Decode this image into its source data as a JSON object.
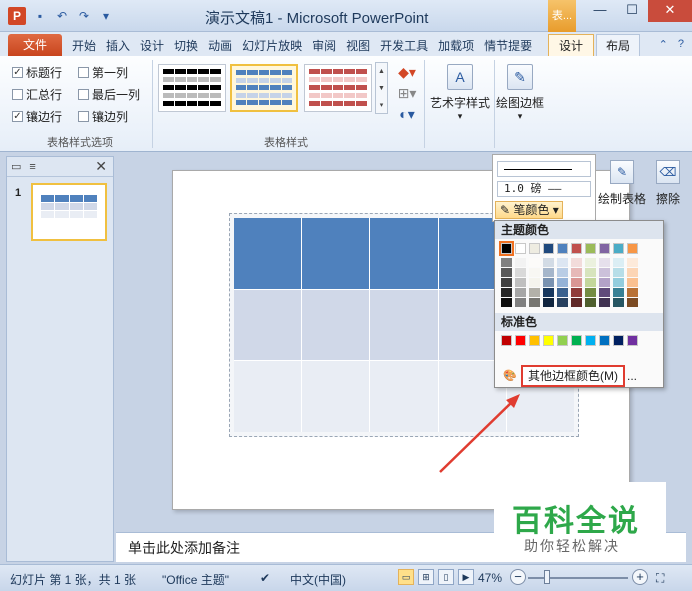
{
  "app": {
    "logo_letter": "P",
    "window_title": "演示文稿1 - Microsoft PowerPoint",
    "context_group": "表...",
    "window_buttons": {
      "minimize": "—",
      "restore": "☐",
      "close": "✕"
    }
  },
  "tabs": {
    "file": "文件",
    "items": [
      "开始",
      "插入",
      "设计",
      "切换",
      "动画",
      "幻灯片放映",
      "审阅",
      "视图",
      "开发工具",
      "加载项",
      "情节提要"
    ],
    "context_design": "设计",
    "context_layout": "布局"
  },
  "ribbon": {
    "options": {
      "header_row": {
        "label": "标题行",
        "checked": true
      },
      "first_column": {
        "label": "第一列",
        "checked": false
      },
      "total_row": {
        "label": "汇总行",
        "checked": false
      },
      "last_column": {
        "label": "最后一列",
        "checked": false
      },
      "banded_rows": {
        "label": "镶边行",
        "checked": true
      },
      "banded_columns": {
        "label": "镶边列",
        "checked": false
      },
      "group_label": "表格样式选项"
    },
    "styles_group_label": "表格样式",
    "wordart_label": "艺术字样式",
    "draw_borders_label": "绘图边框"
  },
  "slides_pane": {
    "slide_number": "1"
  },
  "border_panel": {
    "weight": "1.0 磅",
    "pen_color": "笔颜色",
    "draw_table": "绘制表格",
    "erase": "擦除"
  },
  "palette": {
    "theme_title": "主题颜色",
    "standard_title": "标准色",
    "more_colors": "其他边框颜色(M)",
    "ellipsis": "...",
    "theme_colors": [
      "#000000",
      "#ffffff",
      "#eeece1",
      "#1f497d",
      "#4f81bd",
      "#c0504d",
      "#9bbb59",
      "#8064a2",
      "#4bacc6",
      "#f79646"
    ],
    "standard_colors": [
      "#c00000",
      "#ff0000",
      "#ffc000",
      "#ffff00",
      "#92d050",
      "#00b050",
      "#00b0f0",
      "#0070c0",
      "#002060",
      "#7030a0"
    ]
  },
  "notes": {
    "placeholder": "单击此处添加备注"
  },
  "watermark": {
    "main": "百科全说",
    "sub": "助你轻松解决"
  },
  "status": {
    "slide_info": "幻灯片 第 1 张，共 1 张",
    "theme": "\"Office 主题\"",
    "language": "中文(中国)",
    "zoom": "47%"
  }
}
